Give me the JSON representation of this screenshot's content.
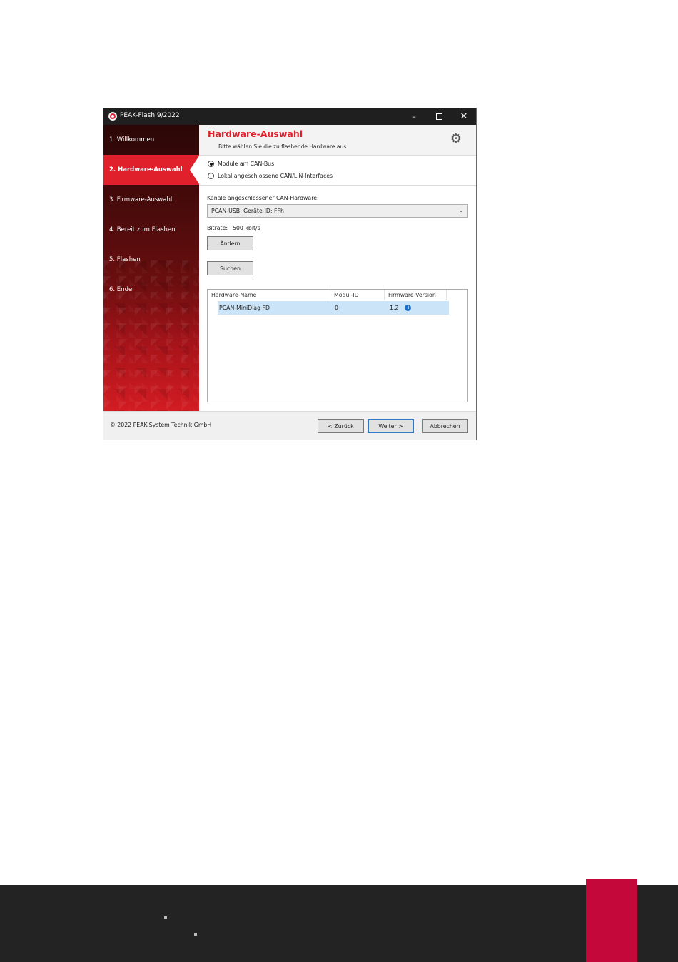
{
  "window": {
    "title": "PEAK-Flash 9/2022",
    "controls": {
      "minimize": "–",
      "close": "✕"
    }
  },
  "sidebar": {
    "steps": [
      {
        "label": "1. Willkommen"
      },
      {
        "label": "2. Hardware-Auswahl",
        "active": true
      },
      {
        "label": "3. Firmware-Auswahl"
      },
      {
        "label": "4. Bereit zum Flashen"
      },
      {
        "label": "5. Flashen"
      },
      {
        "label": "6. Ende"
      }
    ]
  },
  "header": {
    "title": "Hardware-Auswahl",
    "subtitle": "Bitte wählen Sie die zu flashende Hardware aus.",
    "settings_icon": "gear-icon"
  },
  "mode": {
    "options": [
      {
        "label": "Module am CAN-Bus",
        "checked": true
      },
      {
        "label": "Lokal angeschlossene CAN/LIN-Interfaces",
        "checked": false
      }
    ]
  },
  "channels": {
    "label": "Kanäle angeschlossener CAN-Hardware:",
    "selected": "PCAN-USB, Geräte-ID: FFh"
  },
  "bitrate": {
    "label": "Bitrate:",
    "value": "500 kbit/s",
    "change_button": "Ändern"
  },
  "search_button": "Suchen",
  "table": {
    "columns": [
      "Hardware-Name",
      "Modul-ID",
      "Firmware-Version"
    ],
    "rows": [
      {
        "name": "PCAN-MiniDiag FD",
        "module_id": "0",
        "firmware": "1.2",
        "info_icon": "info-icon"
      }
    ]
  },
  "footer": {
    "copyright": "© 2022 PEAK-System Technik GmbH",
    "back": "< Zurück",
    "next": "Weiter >",
    "cancel": "Abbrechen"
  },
  "colors": {
    "accent": "#e0202a",
    "titlebar": "#1f1f1f",
    "selection": "#cce4f7",
    "page_footer": "#232323",
    "page_tab": "#c4083a"
  }
}
